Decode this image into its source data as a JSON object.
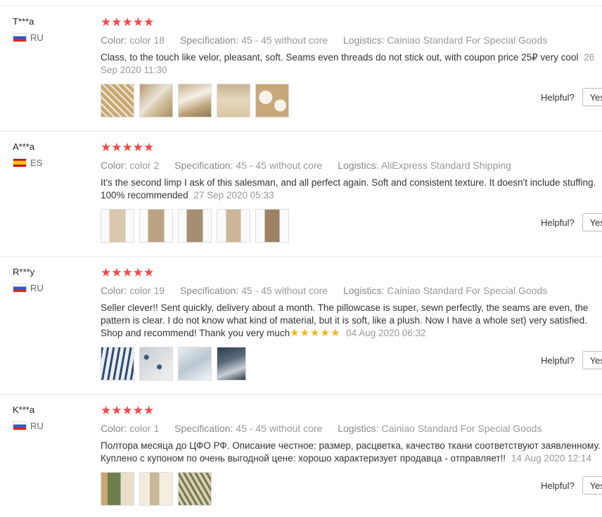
{
  "labels": {
    "color": "Color:",
    "specification": "Specification:",
    "logistics": "Logistics:",
    "helpful": "Helpful?",
    "yes": "Yes"
  },
  "reviews": [
    {
      "user": "T***a",
      "country": "RU",
      "stars": "★★★★★",
      "color": "color 18",
      "specification": "45 - 45 without core",
      "logistics": "Cainiao Standard For Special Goods",
      "text": "Class, to the touch like velor, pleasant, soft. Seams even threads do not stick out, with coupon price 25₽ very cool",
      "date": "26 Sep 2020 11:30"
    },
    {
      "user": "A***a",
      "country": "ES",
      "stars": "★★★★★",
      "color": "color 2",
      "specification": "45 - 45 without core",
      "logistics": "AliExpress Standard Shipping",
      "text": "It's the second limp I ask of this salesman, and all perfect again. Soft and consistent texture. It doesn't include stuffing. 100% recommended",
      "date": "27 Sep 2020 05:33"
    },
    {
      "user": "R***y",
      "country": "RU",
      "stars": "★★★★★",
      "color": "color 19",
      "specification": "45 - 45 without core",
      "logistics": "Cainiao Standard For Special Goods",
      "text": "Seller clever!! Sent quickly, delivery about a month. The pillowcase is super, sewn perfectly, the seams are even, the pattern is clear. I do not know what kind of material, but it is soft, like a plush. Now I have a whole set) very satisfied. Shop and recommend! Thank you very much",
      "inline_stars": "★★★★★",
      "date": "04 Aug 2020 06:32"
    },
    {
      "user": "K***a",
      "country": "RU",
      "stars": "★★★★★",
      "color": "color 1",
      "specification": "45 - 45 without core",
      "logistics": "Cainiao Standard For Special Goods",
      "text": "Полтора месяца до ЦФО РФ. Описание честное: размер, расцветка, качество ткани соответствуют заявленному. Куплено с купоном по очень выгодной цене: хорошо характеризует продавца - отправляет!!",
      "date": "14 Aug 2020 12:14"
    }
  ]
}
